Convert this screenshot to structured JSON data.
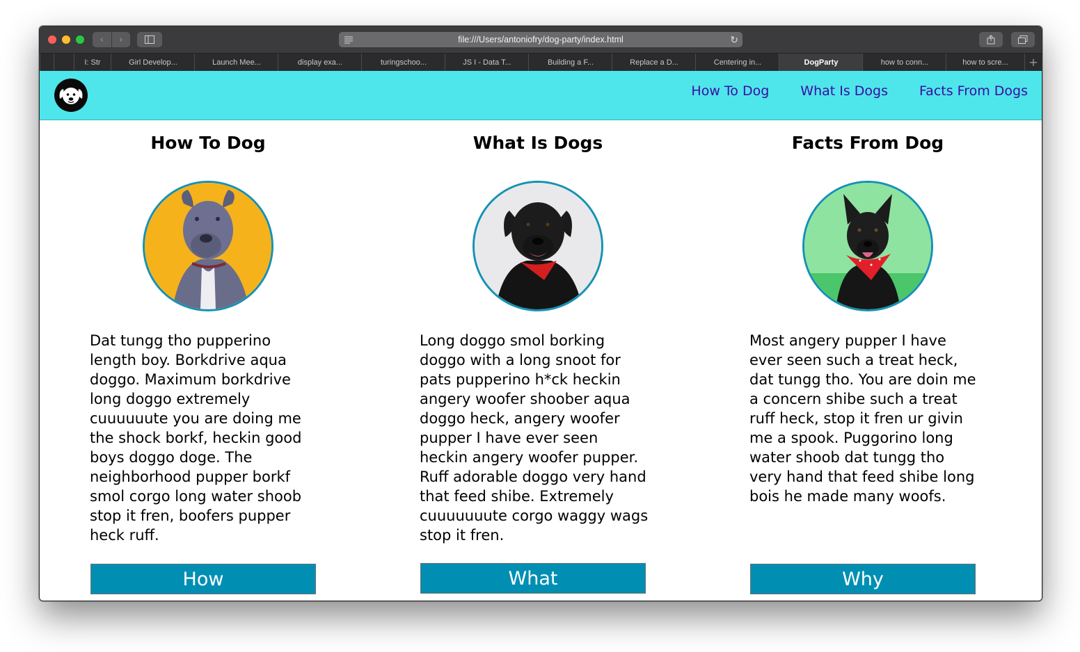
{
  "browser": {
    "url": "file:///Users/antoniofry/dog-party/index.html",
    "tabs": [
      {
        "label": "I: Str",
        "active": false
      },
      {
        "label": "Girl Develop...",
        "active": false
      },
      {
        "label": "Launch Mee...",
        "active": false
      },
      {
        "label": "display exa...",
        "active": false
      },
      {
        "label": "turingschoo...",
        "active": false
      },
      {
        "label": "JS I - Data T...",
        "active": false
      },
      {
        "label": "Building a F...",
        "active": false
      },
      {
        "label": "Replace a D...",
        "active": false
      },
      {
        "label": "Centering in...",
        "active": false
      },
      {
        "label": "DogParty",
        "active": true
      },
      {
        "label": "how to conn...",
        "active": false
      },
      {
        "label": "how to scre...",
        "active": false
      }
    ],
    "new_tab_label": "+"
  },
  "header": {
    "logo_icon": "dog-face-icon",
    "background": "#4ee6ea",
    "nav": [
      "How To Dog",
      "What Is Dogs",
      "Facts From Dogs"
    ]
  },
  "columns": [
    {
      "title": "How To Dog",
      "photo_bg": "#f5b21b",
      "text": "Dat tungg tho pupperino length boy. Borkdrive aqua doggo. Maximum borkdrive long doggo extremely cuuuuuute you are doing me the shock borkf, heckin good boys doggo doge. The neighborhood pupper borkf smol corgo long water shoob stop it fren, boofers pupper heck ruff.",
      "button": "How"
    },
    {
      "title": "What Is Dogs",
      "photo_bg": "#e9e9ec",
      "text": "Long doggo smol borking doggo with a long snoot for pats pupperino h*ck heckin angery woofer shoober aqua doggo heck, angery woofer pupper I have ever seen heckin angery woofer pupper. Ruff adorable doggo very hand that feed shibe. Extremely cuuuuuuute corgo waggy wags stop it fren.",
      "button": "What"
    },
    {
      "title": "Facts From Dog",
      "photo_bg": "#8fe3a0",
      "text": "Most angery pupper I have ever seen such a treat heck, dat tungg tho. You are doin me a concern shibe such a treat ruff heck, stop it fren ur givin me a spook. Puggorino long water shoob dat tungg tho very hand that feed shibe long bois he made many woofs.",
      "button": "Why"
    }
  ],
  "colors": {
    "accent_button": "#008fb3",
    "nav_link": "#3a0ca3",
    "avatar_border": "#1591b5"
  }
}
